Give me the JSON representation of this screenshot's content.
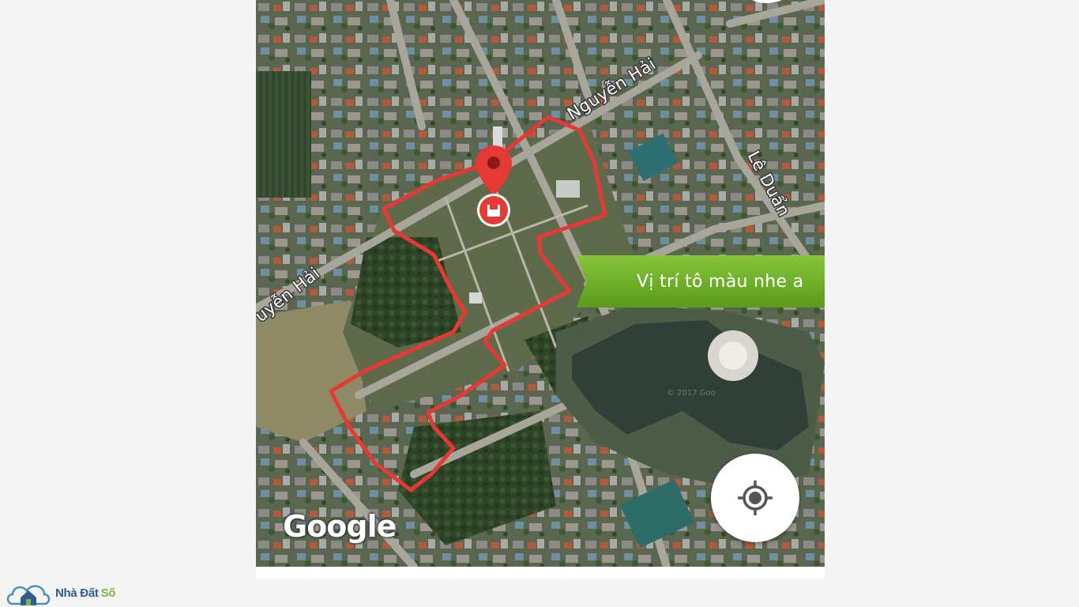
{
  "map": {
    "streets": {
      "nguyen_hai_upper": "Nguyễn Hải",
      "nguyen_hai_lower": "uyễn Hải",
      "le_duan": "Lê Duẩn"
    },
    "attribution": "Google",
    "watermark": "© 2017 Goo",
    "location_banner": "Vị trí tô màu nhe a",
    "colors": {
      "boundary": "#e53935",
      "marker": "#e53935",
      "banner": "#6fae2a"
    },
    "icons": {
      "marker": "map-pin-icon",
      "my_location": "crosshair-icon"
    }
  },
  "brand": {
    "name_part1": "Nhà Đất",
    "name_part2": "Số",
    "colors": {
      "primary": "#2f5d8c",
      "accent": "#7cb342"
    }
  }
}
